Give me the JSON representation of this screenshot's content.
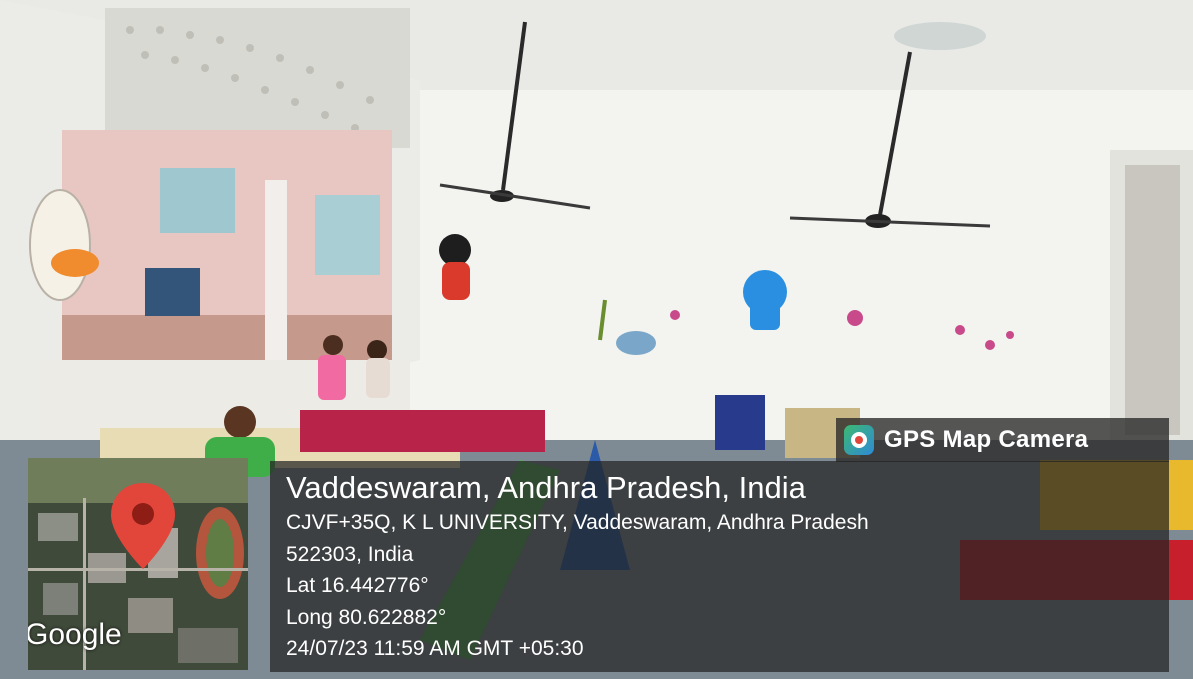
{
  "badge": {
    "label": "GPS Map Camera"
  },
  "map": {
    "provider_label": "Google"
  },
  "location": {
    "title": "Vaddeswaram, Andhra Pradesh, India",
    "address_line1": "CJVF+35Q, K L UNIVERSITY, Vaddeswaram, Andhra Pradesh",
    "address_line2": "522303, India",
    "latitude": "Lat 16.442776°",
    "longitude": "Long 80.622882°",
    "timestamp": "24/07/23 11:59 AM GMT +05:30"
  },
  "colors": {
    "pin_red": "#e2463a",
    "panel": "#232323",
    "wall": "#f2f1ee",
    "floor": "#7f8b94"
  }
}
